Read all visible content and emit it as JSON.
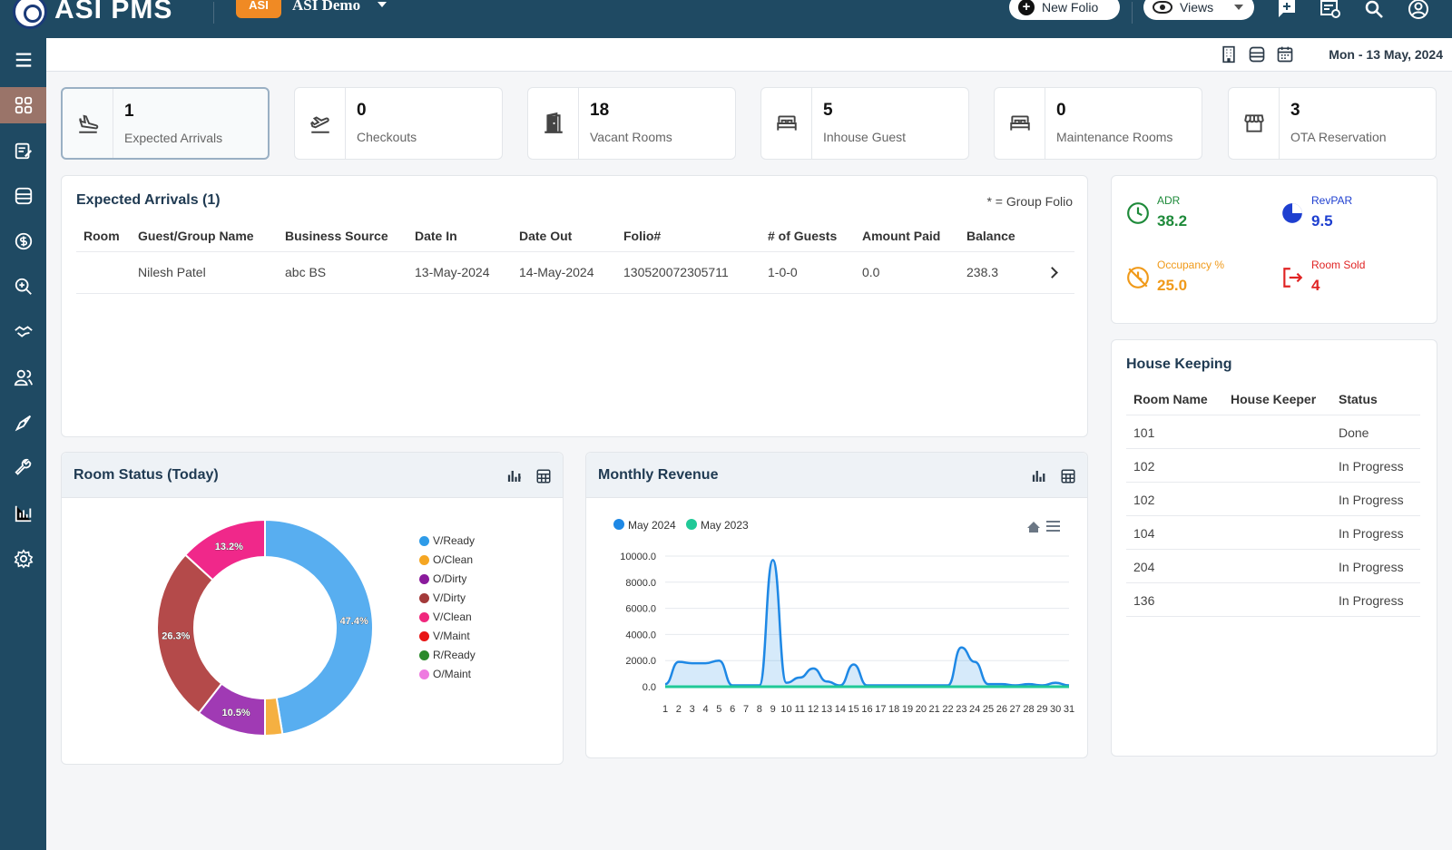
{
  "app": {
    "title": "ASI PMS",
    "badge": "ASI",
    "property_name": "ASI Demo",
    "new_folio_label": "New Folio",
    "views_label": "Views"
  },
  "subheader": {
    "date": "Mon - 13 May, 2024"
  },
  "sidebar": {
    "items": [
      {
        "icon": "menu-icon"
      },
      {
        "icon": "dashboard-icon",
        "active": true
      },
      {
        "icon": "reservation-icon"
      },
      {
        "icon": "room-icon"
      },
      {
        "icon": "dollar-icon"
      },
      {
        "icon": "search-report-icon"
      },
      {
        "icon": "handshake-icon"
      },
      {
        "icon": "users-icon"
      },
      {
        "icon": "marketing-icon"
      },
      {
        "icon": "wrench-icon"
      },
      {
        "icon": "bar-chart-icon"
      },
      {
        "icon": "settings-icon"
      }
    ]
  },
  "stats": [
    {
      "count": "1",
      "label": "Expected Arrivals",
      "icon": "plane-landing-icon"
    },
    {
      "count": "0",
      "label": "Checkouts",
      "icon": "plane-departure-icon"
    },
    {
      "count": "18",
      "label": "Vacant Rooms",
      "icon": "door-icon"
    },
    {
      "count": "5",
      "label": "Inhouse Guest",
      "icon": "bed-icon"
    },
    {
      "count": "0",
      "label": "Maintenance Rooms",
      "icon": "bed-icon"
    },
    {
      "count": "3",
      "label": "OTA Reservation",
      "icon": "store-icon"
    }
  ],
  "arrivals": {
    "title": "Expected Arrivals (1)",
    "group_note": "* = Group Folio",
    "columns": [
      "Room",
      "Guest/Group Name",
      "Business Source",
      "Date In",
      "Date Out",
      "Folio#",
      "# of Guests",
      "Amount Paid",
      "Balance"
    ],
    "rows": [
      {
        "room": "",
        "guest": "Nilesh Patel",
        "source": "abc BS",
        "date_in": "13-May-2024",
        "date_out": "14-May-2024",
        "folio": "130520072305711",
        "guests": "1-0-0",
        "paid": "0.0",
        "balance": "238.3"
      }
    ]
  },
  "metrics": {
    "adr": {
      "label": "ADR",
      "value": "38.2",
      "color": "#1e8a3a"
    },
    "revpar": {
      "label": "RevPAR",
      "value": "9.5",
      "color": "#1e3fd0"
    },
    "occupancy": {
      "label": "Occupancy %",
      "value": "25.0",
      "color": "#f09a1a"
    },
    "room_sold": {
      "label": "Room Sold",
      "value": "4",
      "color": "#e02424"
    }
  },
  "housekeeping": {
    "title": "House Keeping",
    "columns": [
      "Room Name",
      "House Keeper",
      "Status"
    ],
    "rows": [
      {
        "room": "101",
        "keeper": "",
        "status": "Done"
      },
      {
        "room": "102",
        "keeper": "",
        "status": "In Progress"
      },
      {
        "room": "102",
        "keeper": "",
        "status": "In Progress"
      },
      {
        "room": "104",
        "keeper": "",
        "status": "In Progress"
      },
      {
        "room": "204",
        "keeper": "",
        "status": "In Progress"
      },
      {
        "room": "136",
        "keeper": "",
        "status": "In Progress"
      }
    ]
  },
  "room_status": {
    "title": "Room Status (Today)",
    "legend": [
      {
        "label": "V/Ready",
        "color": "#2e9be8"
      },
      {
        "label": "O/Clean",
        "color": "#f5a623"
      },
      {
        "label": "O/Dirty",
        "color": "#8a1a9c"
      },
      {
        "label": "V/Dirty",
        "color": "#a33a3a"
      },
      {
        "label": "V/Clean",
        "color": "#f0287d"
      },
      {
        "label": "V/Maint",
        "color": "#e81414"
      },
      {
        "label": "R/Ready",
        "color": "#2a8a2a"
      },
      {
        "label": "O/Maint",
        "color": "#ee7ae0"
      }
    ]
  },
  "revenue": {
    "title": "Monthly Revenue"
  },
  "chart_data": [
    {
      "type": "pie",
      "title": "Room Status (Today)",
      "slices": [
        {
          "name": "V/Ready",
          "value": 47.4,
          "color": "#58aef0",
          "label": "47.4%"
        },
        {
          "name": "O/Clean",
          "value": 2.6,
          "color": "#f5b041",
          "label": ""
        },
        {
          "name": "O/Dirty",
          "value": 10.5,
          "color": "#a03ab4",
          "label": "10.5%"
        },
        {
          "name": "V/Dirty",
          "value": 26.3,
          "color": "#b44a4a",
          "label": "26.3%"
        },
        {
          "name": "V/Clean",
          "value": 13.2,
          "color": "#f0288a",
          "label": "13.2%"
        }
      ]
    },
    {
      "type": "area",
      "title": "Monthly Revenue",
      "categories": [
        "1",
        "2",
        "3",
        "4",
        "5",
        "6",
        "7",
        "8",
        "9",
        "10",
        "11",
        "12",
        "13",
        "14",
        "15",
        "16",
        "17",
        "18",
        "19",
        "20",
        "21",
        "22",
        "23",
        "24",
        "25",
        "26",
        "27",
        "28",
        "29",
        "30",
        "31"
      ],
      "ylim": [
        0,
        10000
      ],
      "yticks": [
        "10000.0",
        "8000.0",
        "6000.0",
        "4000.0",
        "2000.0",
        "0.0"
      ],
      "legend": [
        {
          "name": "May 2024",
          "color": "#1e88e5"
        },
        {
          "name": "May 2023",
          "color": "#20c997"
        }
      ],
      "series": [
        {
          "name": "May 2024",
          "color": "#1e88e5",
          "values": [
            200,
            1900,
            1800,
            1800,
            2000,
            100,
            100,
            100,
            9700,
            300,
            700,
            1400,
            400,
            100,
            1700,
            100,
            100,
            100,
            100,
            100,
            100,
            100,
            3000,
            1900,
            200,
            200,
            100,
            200,
            100,
            300,
            100
          ]
        },
        {
          "name": "May 2023",
          "color": "#20c997",
          "values": [
            0,
            0,
            0,
            0,
            0,
            0,
            0,
            0,
            0,
            0,
            0,
            0,
            0,
            0,
            0,
            0,
            0,
            0,
            0,
            0,
            0,
            0,
            0,
            0,
            0,
            0,
            0,
            0,
            0,
            0,
            0
          ]
        }
      ]
    }
  ]
}
